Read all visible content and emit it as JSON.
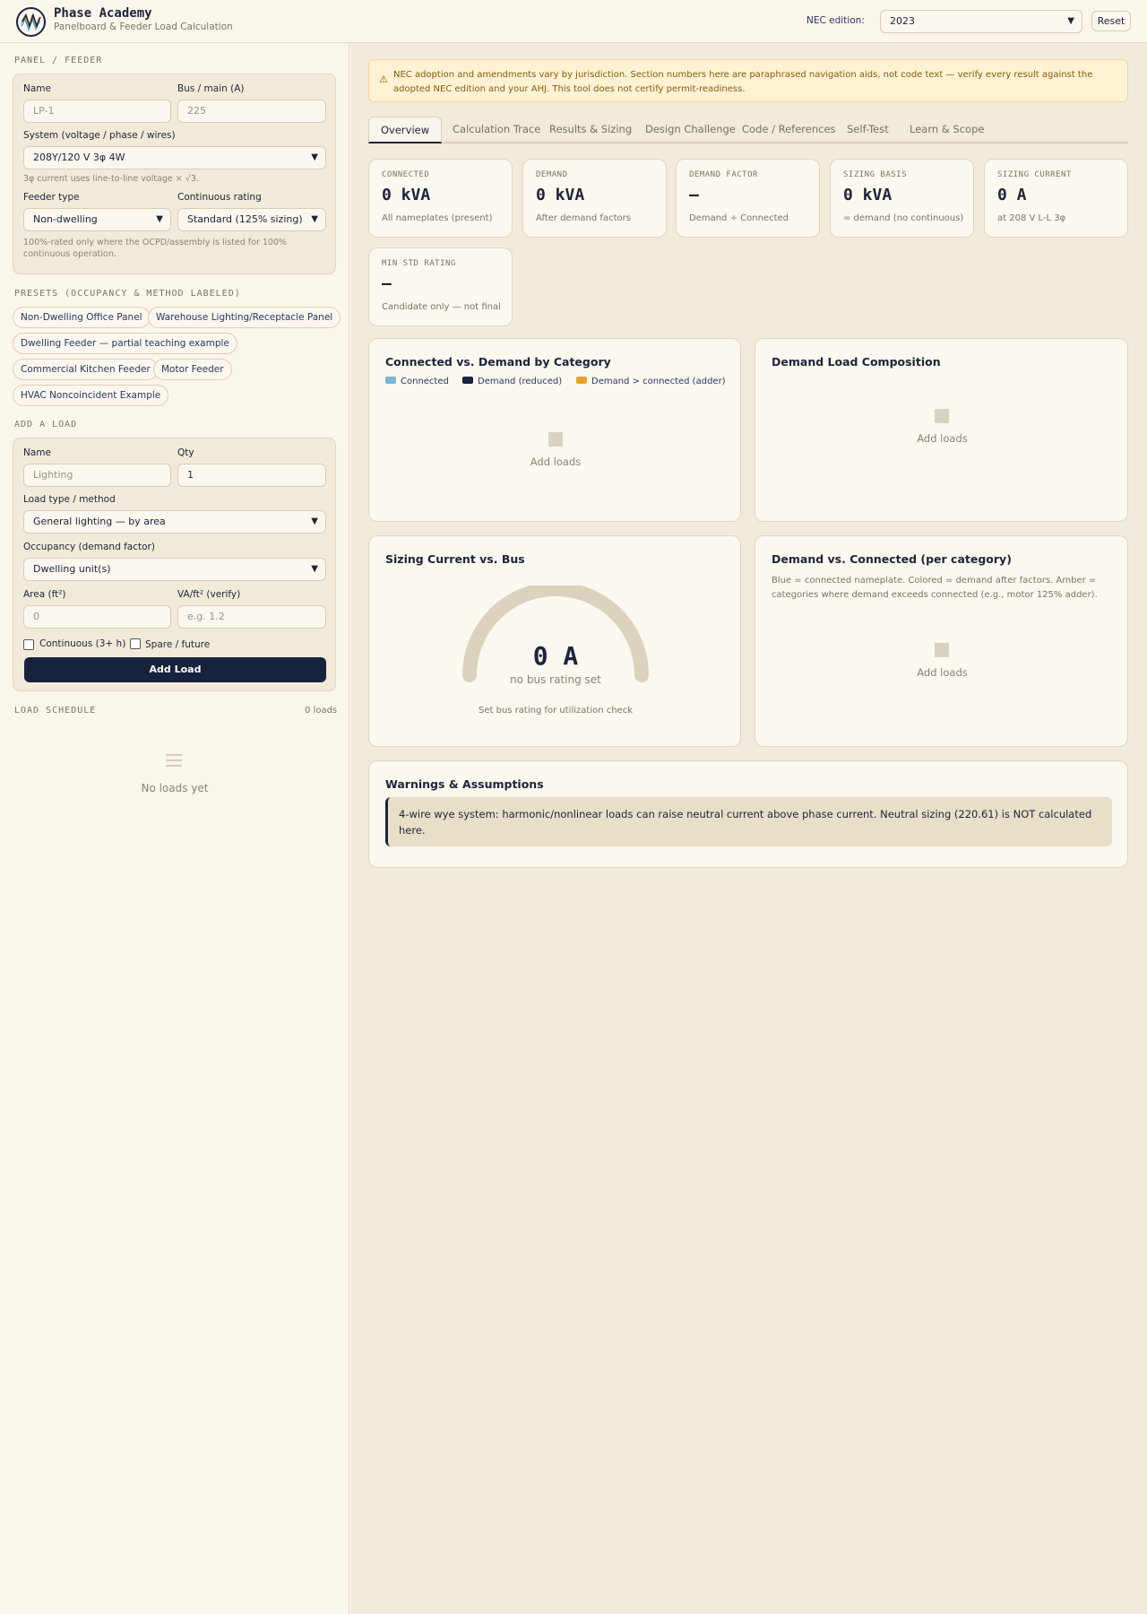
{
  "header": {
    "brand_name": "Phase Academy",
    "brand_subtitle": "Panelboard & Feeder Load Calculation",
    "edition_label": "NEC edition:",
    "edition_value": "2023",
    "reset_label": "Reset"
  },
  "sidebar": {
    "panel_section_title": "PANEL / FEEDER",
    "panel": {
      "name_label": "Name",
      "name_placeholder": "LP-1",
      "bus_label": "Bus / main (A)",
      "bus_placeholder": "225",
      "system_label": "System (voltage / phase / wires)",
      "system_value": "208Y/120 V 3φ 4W",
      "system_note": "3φ current uses line-to-line voltage × √3.",
      "feeder_type_label": "Feeder type",
      "feeder_type_value": "Non-dwelling",
      "continuous_label": "Continuous rating",
      "continuous_value": "Standard (125% sizing)",
      "rating_note": "100%-rated only where the OCPD/assembly is listed for 100% continuous operation."
    },
    "presets_title": "PRESETS (OCCUPANCY & METHOD LABELED)",
    "presets": [
      "Non-Dwelling Office Panel",
      "Warehouse Lighting/Receptacle Panel",
      "Dwelling Feeder — partial teaching example",
      "Commercial Kitchen Feeder",
      "Motor Feeder",
      "HVAC Noncoincident Example"
    ],
    "add_load_title": "ADD A LOAD",
    "add_load": {
      "name_label": "Name",
      "name_placeholder": "Lighting",
      "qty_label": "Qty",
      "qty_value": "1",
      "load_type_label": "Load type / method",
      "load_type_value": "General lighting — by area",
      "occupancy_label": "Occupancy (demand factor)",
      "occupancy_value": "Dwelling unit(s)",
      "area_label": "Area (ft²)",
      "area_placeholder": "0",
      "va_label": "VA/ft² (verify)",
      "va_placeholder": "e.g. 1.2",
      "continuous_check": "Continuous (3+ h)",
      "spare_check": "Spare / future",
      "add_button": "Add Load"
    },
    "schedule_title": "LOAD SCHEDULE",
    "schedule_count": "0 loads",
    "schedule_empty": "No loads yet"
  },
  "main": {
    "alert": "NEC adoption and amendments vary by jurisdiction. Section numbers here are paraphrased navigation aids, not code text — verify every result against the adopted NEC edition and your AHJ. This tool does not certify permit-readiness.",
    "tabs": [
      "Overview",
      "Calculation Trace",
      "Results & Sizing",
      "Design Challenge",
      "Code / References",
      "Self-Test",
      "Learn & Scope"
    ],
    "stats": [
      {
        "label": "CONNECTED",
        "value": "0 kVA",
        "sub": "All nameplates (present)"
      },
      {
        "label": "DEMAND",
        "value": "0 kVA",
        "sub": "After demand factors"
      },
      {
        "label": "DEMAND FACTOR",
        "value": "—",
        "sub": "Demand ÷ Connected"
      },
      {
        "label": "SIZING BASIS",
        "value": "0 kVA",
        "sub": "= demand (no continuous)"
      },
      {
        "label": "SIZING CURRENT",
        "value": "0 A",
        "sub": "at 208 V L-L 3φ"
      },
      {
        "label": "MIN STD RATING",
        "value": "—",
        "sub": "Candidate only — not final"
      }
    ],
    "chart1": {
      "title": "Connected vs. Demand by Category",
      "legend": [
        "Connected",
        "Demand (reduced)",
        "Demand > connected (adder)"
      ],
      "empty": "Add loads"
    },
    "chart2": {
      "title": "Demand Load Composition",
      "empty": "Add loads"
    },
    "gauge": {
      "title": "Sizing Current vs. Bus",
      "value": "0 A",
      "sub": "no bus rating set",
      "note": "Set bus rating for utilization check",
      "level": 0
    },
    "chart4": {
      "title": "Demand vs. Connected (per category)",
      "description": "Blue = connected nameplate. Colored = demand after factors. Amber = categories where demand exceeds connected (e.g., motor 125% adder).",
      "empty": "Add loads"
    },
    "warnings": {
      "title": "Warnings & Assumptions",
      "items": [
        "4-wire wye system: harmonic/nonlinear loads can raise neutral current above phase current. Neutral sizing (220.61) is NOT calculated here."
      ]
    }
  },
  "colors": {
    "navy": "#17223d",
    "connected": "#7fb3d8",
    "demand": "#17223d",
    "adder": "#e3a22a",
    "alert_bg": "#fdf2d4"
  },
  "icons": [
    "logo-wave-icon",
    "chevron-down-icon",
    "warning-icon",
    "list-icon"
  ]
}
